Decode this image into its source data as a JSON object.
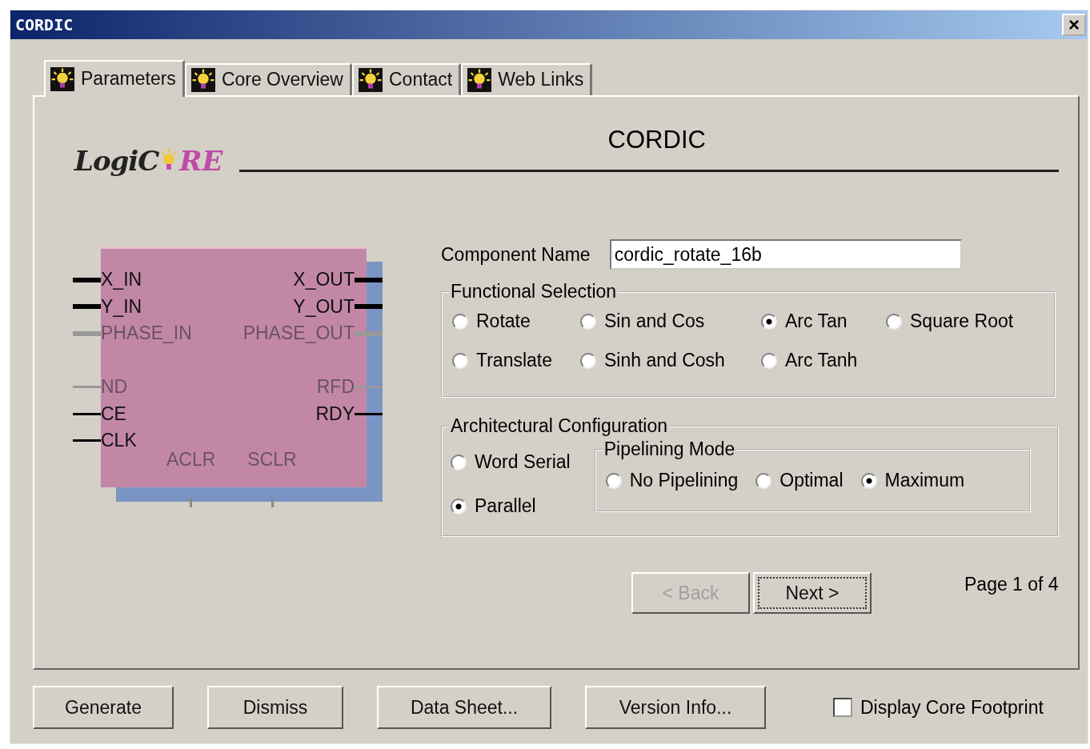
{
  "window": {
    "title": "CORDIC",
    "close": "×"
  },
  "tabs": [
    {
      "label": "Parameters",
      "selected": true
    },
    {
      "label": "Core Overview",
      "selected": false
    },
    {
      "label": "Contact",
      "selected": false
    },
    {
      "label": "Web Links",
      "selected": false
    }
  ],
  "logo": {
    "before": "LogiC",
    "after": "RE"
  },
  "heading": "CORDIC",
  "symbol": {
    "left_pins": [
      {
        "label": "X_IN",
        "enabled": true,
        "bus": true
      },
      {
        "label": "Y_IN",
        "enabled": true,
        "bus": true
      },
      {
        "label": "PHASE_IN",
        "enabled": false,
        "bus": true
      },
      {
        "label": "ND",
        "enabled": false,
        "bus": false
      },
      {
        "label": "CE",
        "enabled": true,
        "bus": false
      },
      {
        "label": "CLK",
        "enabled": true,
        "bus": false
      }
    ],
    "right_pins": [
      {
        "label": "X_OUT",
        "enabled": true,
        "bus": true
      },
      {
        "label": "Y_OUT",
        "enabled": true,
        "bus": true
      },
      {
        "label": "PHASE_OUT",
        "enabled": false,
        "bus": true
      },
      {
        "label": "RFD",
        "enabled": false,
        "bus": false
      },
      {
        "label": "RDY",
        "enabled": true,
        "bus": false
      }
    ],
    "bottom_pins": [
      {
        "label": "ACLR",
        "enabled": false
      },
      {
        "label": "SCLR",
        "enabled": false
      }
    ]
  },
  "component_name": {
    "label": "Component Name",
    "value": "cordic_rotate_16b"
  },
  "functional_selection": {
    "title": "Functional Selection",
    "options": [
      {
        "label": "Rotate",
        "selected": false
      },
      {
        "label": "Sin and Cos",
        "selected": false
      },
      {
        "label": "Arc Tan",
        "selected": true
      },
      {
        "label": "Square Root",
        "selected": false
      },
      {
        "label": "Translate",
        "selected": false
      },
      {
        "label": "Sinh and Cosh",
        "selected": false
      },
      {
        "label": "Arc Tanh",
        "selected": false
      }
    ]
  },
  "architectural_configuration": {
    "title": "Architectural Configuration",
    "options": [
      {
        "label": "Word Serial",
        "selected": false
      },
      {
        "label": "Parallel",
        "selected": true
      }
    ],
    "pipelining_mode": {
      "title": "Pipelining Mode",
      "options": [
        {
          "label": "No Pipelining",
          "selected": false
        },
        {
          "label": "Optimal",
          "selected": false
        },
        {
          "label": "Maximum",
          "selected": true
        }
      ]
    }
  },
  "navigation": {
    "back": {
      "label": "< Back",
      "disabled": true
    },
    "next": {
      "label": "Next >",
      "disabled": false
    },
    "page": "Page 1 of 4"
  },
  "buttons": [
    "Generate",
    "Dismiss",
    "Data Sheet...",
    "Version Info..."
  ],
  "display_core_footprint": {
    "label": "Display Core Footprint",
    "checked": false
  }
}
